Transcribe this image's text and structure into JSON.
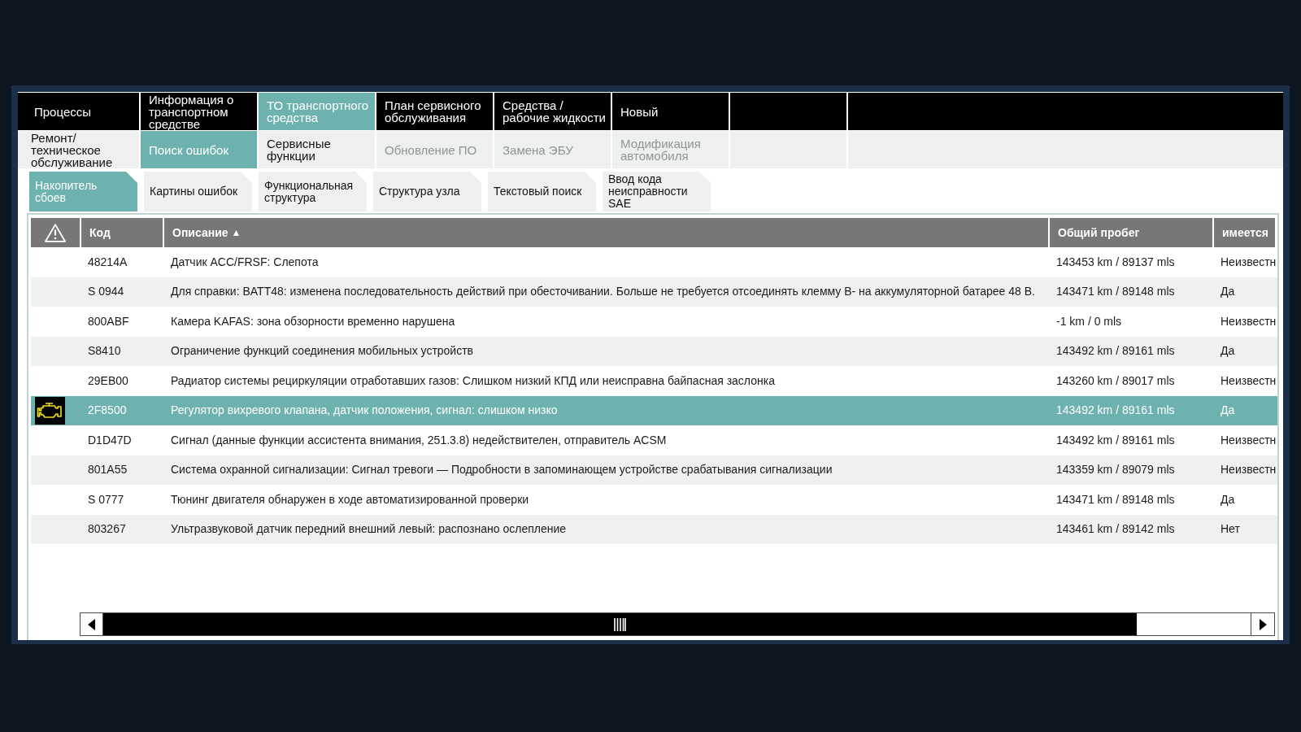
{
  "main_tabs": [
    {
      "label": "Процессы",
      "selected": false
    },
    {
      "label": "Информация о транспортном средстве",
      "selected": false
    },
    {
      "label": "ТО транспортного средства",
      "selected": true
    },
    {
      "label": "План сервисного обслуживания",
      "selected": false
    },
    {
      "label": "Средства / рабочие жидкости",
      "selected": false
    },
    {
      "label": "Новый",
      "selected": false
    }
  ],
  "sub_tabs": [
    {
      "label": "Ремонт/ техническое обслуживание",
      "selected": false,
      "disabled": false
    },
    {
      "label": "Поиск ошибок",
      "selected": true,
      "disabled": false
    },
    {
      "label": "Сервисные функции",
      "selected": false,
      "disabled": false
    },
    {
      "label": "Обновление ПО",
      "selected": false,
      "disabled": true
    },
    {
      "label": "Замена ЭБУ",
      "selected": false,
      "disabled": true
    },
    {
      "label": "Модификация автомобиля",
      "selected": false,
      "disabled": true
    }
  ],
  "function_tabs": [
    {
      "label": "Накопитель сбоев",
      "selected": true
    },
    {
      "label": "Картины ошибок",
      "selected": false
    },
    {
      "label": "Функциональная структура",
      "selected": false
    },
    {
      "label": "Структура узла",
      "selected": false
    },
    {
      "label": "Текстовый поиск",
      "selected": false
    },
    {
      "label": "Ввод кода неисправности SAE",
      "selected": false
    }
  ],
  "fault_table": {
    "columns": [
      {
        "label": "Код"
      },
      {
        "label": "Описание",
        "sort_mark": "▲"
      },
      {
        "label": "Общий пробег"
      },
      {
        "label": "имеется"
      }
    ],
    "rows": [
      {
        "code": "48214A",
        "description": "Датчик ACC/FRSF: Слепота",
        "mileage": "143453 km / 89137 mls",
        "present": "Неизвестн",
        "lamp": false,
        "selected": false
      },
      {
        "code": "S 0944",
        "description": "Для справки: BATT48: изменена последовательность действий при обесточивании. Больше не требуется отсоединять клемму B- на аккумуляторной батарее 48 B.",
        "mileage": "143471 km / 89148 mls",
        "present": "Да",
        "lamp": false,
        "selected": false
      },
      {
        "code": "800ABF",
        "description": "Камера KAFAS: зона обзорности временно нарушена",
        "mileage": "-1 km / 0 mls",
        "present": "Неизвестн",
        "lamp": false,
        "selected": false
      },
      {
        "code": "S8410",
        "description": "Ограничение функций соединения мобильных устройств",
        "mileage": "143492 km / 89161 mls",
        "present": "Да",
        "lamp": false,
        "selected": false
      },
      {
        "code": "29EB00",
        "description": "Радиатор системы рециркуляции отработавших газов: Слишком низкий КПД или неисправна байпасная заслонка",
        "mileage": "143260 km / 89017 mls",
        "present": "Неизвестн",
        "lamp": false,
        "selected": false
      },
      {
        "code": "2F8500",
        "description": "Регулятор вихревого клапана, датчик положения, сигнал: слишком низко",
        "mileage": "143492 km / 89161 mls",
        "present": "Да",
        "lamp": true,
        "selected": true
      },
      {
        "code": "D1D47D",
        "description": "Сигнал (данные функции ассистента внимания, 251.3.8) недействителен, отправитель ACSM",
        "mileage": "143492 km / 89161 mls",
        "present": "Неизвестн",
        "lamp": false,
        "selected": false
      },
      {
        "code": "801A55",
        "description": "Система охранной сигнализации: Сигнал тревоги — Подробности в запоминающем устройстве срабатывания сигнализации",
        "mileage": "143359 km / 89079 mls",
        "present": "Неизвестн",
        "lamp": false,
        "selected": false
      },
      {
        "code": "S 0777",
        "description": "Тюнинг двигателя обнаружен в ходе автоматизированной проверки",
        "mileage": "143471 km / 89148 mls",
        "present": "Да",
        "lamp": false,
        "selected": false
      },
      {
        "code": "803267",
        "description": "Ультразвуковой датчик передний внешний левый: распознано ослепление",
        "mileage": "143461 km / 89142 mls",
        "present": "Нет",
        "lamp": false,
        "selected": false
      }
    ]
  }
}
